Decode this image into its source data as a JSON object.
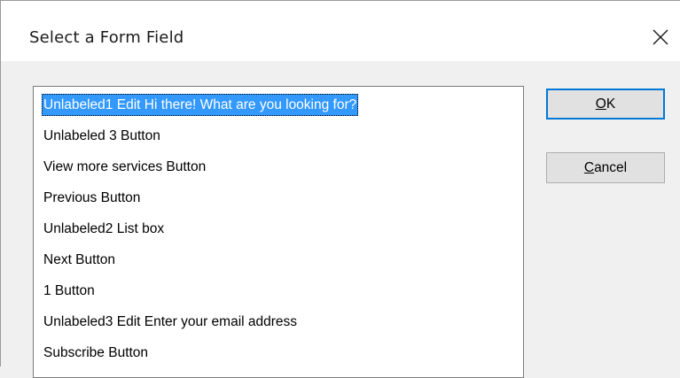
{
  "dialog": {
    "title": "Select a Form Field"
  },
  "list": {
    "items": [
      {
        "label": "Unlabeled1 Edit Hi there! What are you looking for?",
        "selected": true
      },
      {
        "label": "Unlabeled 3 Button",
        "selected": false
      },
      {
        "label": "View more services Button",
        "selected": false
      },
      {
        "label": "Previous Button",
        "selected": false
      },
      {
        "label": "Unlabeled2 List box",
        "selected": false
      },
      {
        "label": "Next Button",
        "selected": false
      },
      {
        "label": "1 Button",
        "selected": false
      },
      {
        "label": "Unlabeled3 Edit Enter your email address",
        "selected": false
      },
      {
        "label": "Subscribe Button",
        "selected": false
      }
    ]
  },
  "buttons": {
    "ok": {
      "mnemonic": "O",
      "rest": "K"
    },
    "cancel": {
      "mnemonic": "C",
      "rest": "ancel"
    }
  },
  "colors": {
    "selection": "#3399ff",
    "default_button_border": "#0078d7",
    "button_face": "#e1e1e1"
  },
  "icons": {
    "close": "close-icon"
  }
}
